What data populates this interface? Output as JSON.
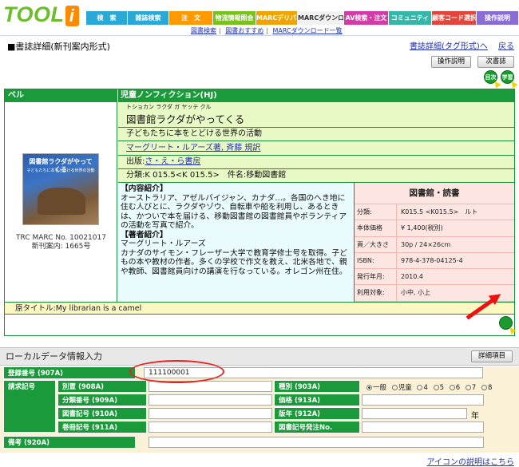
{
  "header": {
    "logo": "TOOL",
    "logo_i": "i",
    "nav": [
      {
        "label": "検　索",
        "color": "#2aa9d6",
        "w": 52
      },
      {
        "label": "雑誌検索",
        "color": "#2aa9d6",
        "w": 52
      },
      {
        "label": "注　文",
        "color": "#ff9a00",
        "w": 55
      },
      {
        "label": "物流情報照会",
        "color": "#79c21a",
        "w": 54
      },
      {
        "label": "MARCデリバリ",
        "color": "#f0a400",
        "w": 52
      },
      {
        "label": "MARCダウンロード",
        "color": "#f2f2f2",
        "w": 58
      },
      {
        "label": "AV検索・注文",
        "color": "#d23ca7",
        "w": 56
      },
      {
        "label": "コミュニティ",
        "color": "#35b6a8",
        "w": 54
      },
      {
        "label": "顧客コード選択",
        "color": "#e3453a",
        "w": 56
      },
      {
        "label": "操作説明",
        "color": "#8a6dd4",
        "w": 53
      }
    ],
    "subnav": [
      "図書検索",
      "図書おすすめ",
      "MARCダウンロード一覧"
    ]
  },
  "page": {
    "title": "■書誌詳細(新刊案内形式)",
    "link_tag_format": "書誌詳細(タグ形式)へ",
    "link_back": "戻る",
    "btn_manual": "操作説明",
    "btn_next": "次書誌",
    "icon_1": "目次",
    "icon_2": "学習"
  },
  "book": {
    "category_label": "ベル",
    "category_value": "児童ノンフィクション(HJ)",
    "ruby": "トショカン ラクダ ガ ヤッテ クル",
    "title": "図書館ラクダがやってくる",
    "subtitle": "子どもたちに本をとどける世界の活動",
    "authors": "マーグリート・ルアーズ著, 斉藤 規訳",
    "publisher_prefix": "出版:",
    "publisher": "さ・え・ら書房",
    "classification": "分類:K 015.5<K 015.5>　件名:移動図書館",
    "cover_title": "図書館ラクダがやってくる",
    "cover_sub": "子どもたちに本をとどける世界の活動",
    "marc_no": "TRC MARC No. 10021017",
    "shinkan_no": "新刊案内: 1665号",
    "content_head": "【内容紹介】",
    "content_text": "オーストラリア、アゼルバイジャン、カナダ…。各国のへき地に住む人びとに、ラクダやゾウ、自転車や船を利用し、あるときは、かついで本を届ける、移動図書館の図書館員やボランティアの活動を写真で紹介。",
    "author_head": "【著者紹介】",
    "author_name": "マーグリート・ルアーズ",
    "author_text": "カナダのサイモン・フレーザー大学で教育学修士号を取得。子どもの本や教材の作者。多くの学校で作文を教え、北米各地で、親や教師、図書館員向けの講演を行なっている。オレゴン州在住。",
    "original_title": "原タイトル:My librarian is a camel"
  },
  "library": {
    "head": "図書館・読書",
    "rows": [
      {
        "k": "分類:",
        "v": "K015.5 <K015.5>　ルト"
      },
      {
        "k": "本体価格",
        "v": "¥ 1,400(税別)"
      },
      {
        "k": "頁／大きさ",
        "v": "30p / 24×26cm"
      },
      {
        "k": "ISBN:",
        "v": "978-4-378-04125-4"
      },
      {
        "k": "発行年月:",
        "v": "2010.4"
      },
      {
        "k": "利用対象:",
        "v": "小中, 小上"
      }
    ]
  },
  "local": {
    "head": "ローカルデータ情報入力",
    "btn_detail": "詳細項目",
    "reg_label": "登録番号 (907A)",
    "reg_value": "111100001",
    "request_label": "請求記号",
    "bessatsu": "別置 (908A)",
    "bunrui": "分類番号 (909A)",
    "tosho": "図書記号 (910A)",
    "kansatsu": "巻冊記号 (911A)",
    "shubetsu": "種別 (903A)",
    "kakaku": "価格 (913A)",
    "hannen": "版年 (912A)",
    "hannen_suffix": "年",
    "hacchu": "図書記号発注No. (918A)",
    "biko": "備考 (920A)",
    "radio_options": [
      "一般",
      "児童",
      "4",
      "5",
      "6",
      "7",
      "8"
    ],
    "radio_selected": "一般",
    "icon_help": "アイコンの説明はこちら"
  }
}
